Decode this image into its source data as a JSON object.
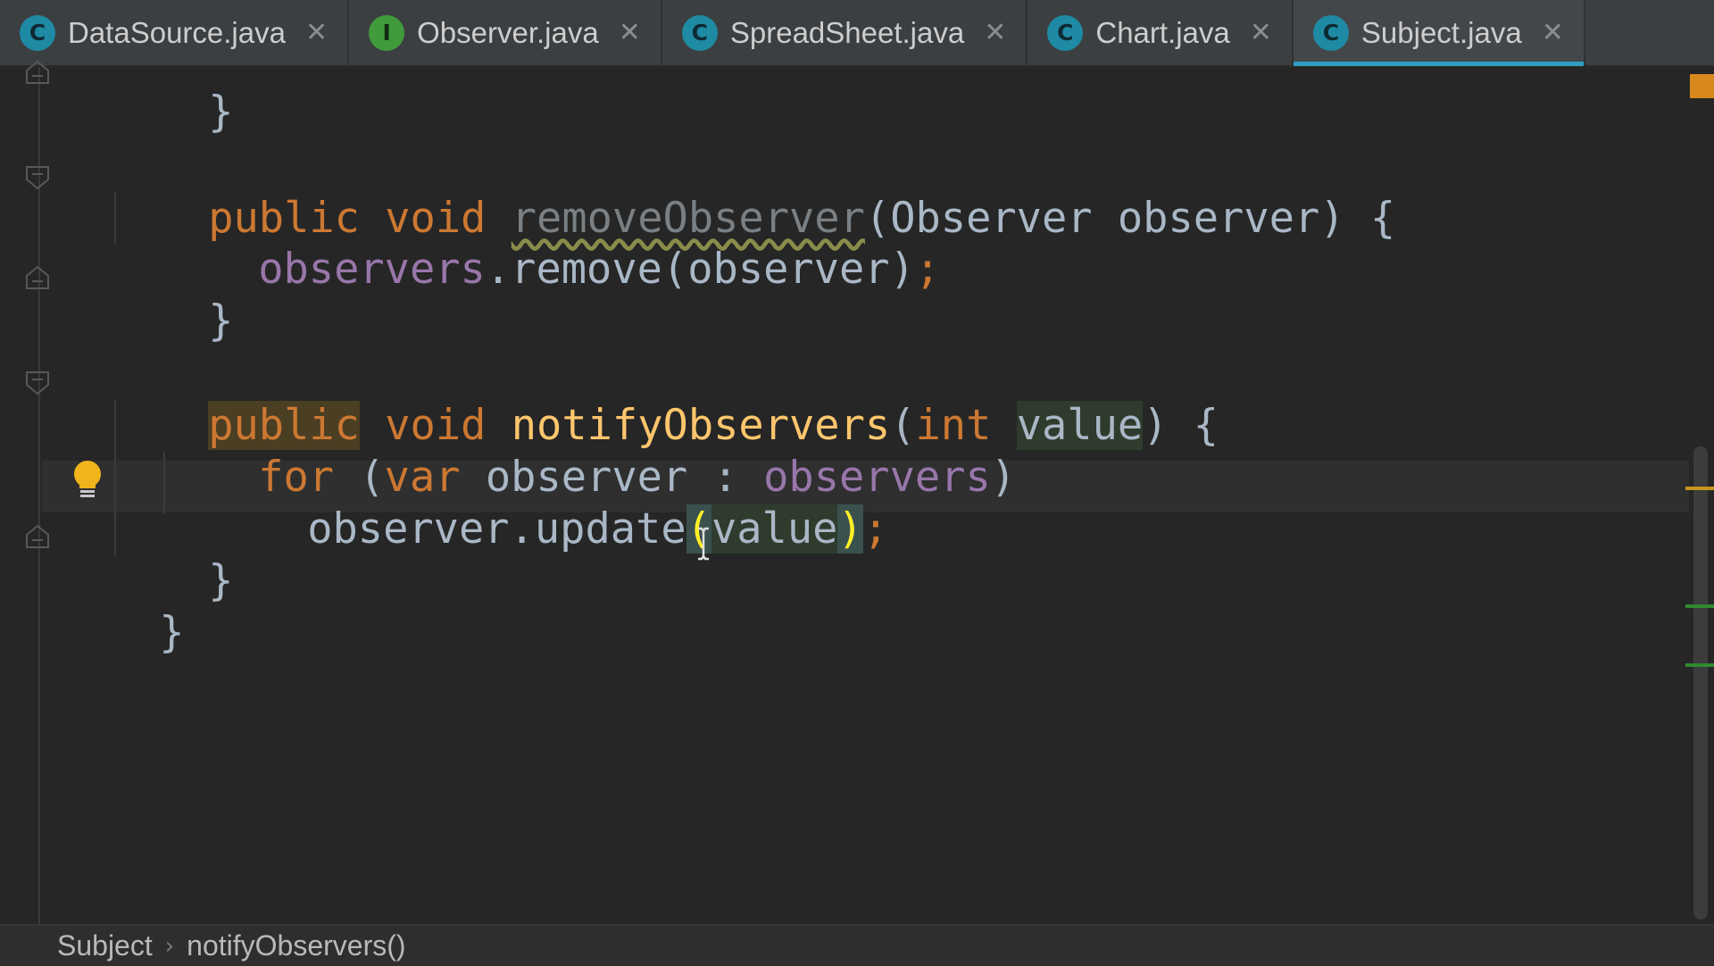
{
  "tabs": [
    {
      "icon_letter": "C",
      "icon_type": "class-icon",
      "label": "DataSource.java",
      "close": "✕"
    },
    {
      "icon_letter": "I",
      "icon_type": "interface-icon",
      "label": "Observer.java",
      "close": "✕"
    },
    {
      "icon_letter": "C",
      "icon_type": "class-icon",
      "label": "SpreadSheet.java",
      "close": "✕"
    },
    {
      "icon_letter": "C",
      "icon_type": "class-icon",
      "label": "Chart.java",
      "close": "✕"
    },
    {
      "icon_letter": "C",
      "icon_type": "class-icon",
      "label": "Subject.java",
      "close": "✕",
      "active": true
    }
  ],
  "code": {
    "l0": "}",
    "l1": {
      "kw1": "public",
      "kw2": "void",
      "name": "removeObserver",
      "params": "(Observer observer) {"
    },
    "l2": {
      "field": "observers",
      "rest": ".remove(observer)",
      "semi": ";"
    },
    "l3": "}",
    "l4": {
      "kw1": "public",
      "kw2": "void",
      "name": "notifyObservers",
      "open": "(",
      "kw3": "int",
      "param": "value",
      "close": ") {"
    },
    "l5": {
      "kw1": "for",
      "mid1": " (",
      "kw2": "var",
      "mid2": " observer : ",
      "field": "observers",
      "end": ")"
    },
    "l6": {
      "a": "observer.update",
      "open": "(",
      "param": "value",
      "close": ")",
      "semi": ";"
    },
    "l7": "}",
    "l8": "}"
  },
  "breadcrumb": {
    "item1": "Subject",
    "sep": "›",
    "item2": "notifyObservers()"
  },
  "colors": {
    "keyword": "#cc7832",
    "method": "#ffc66d",
    "field": "#9876aa",
    "text": "#a9b7c6",
    "accent": "#2f9ec2"
  }
}
